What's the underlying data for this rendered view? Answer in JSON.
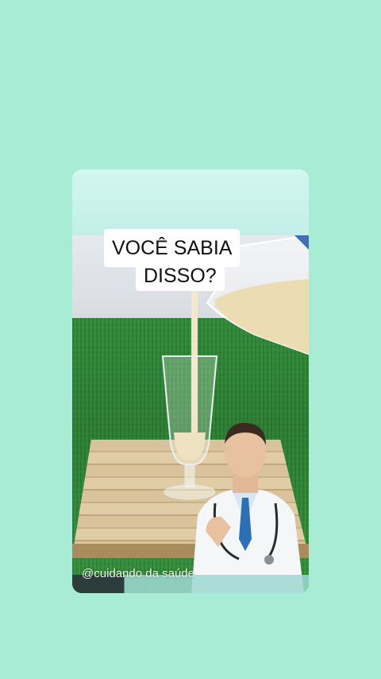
{
  "overlay": {
    "line1": "VOCÊ SABIA",
    "line2": "DISSO?"
  },
  "watermark": "@cuidando da saúde",
  "colors": {
    "background": "#a8ecd6",
    "card": "#c7f3ec",
    "grass": "#2f8a38",
    "board": "#d8c39c",
    "drink": "#eadbb6",
    "coat": "#f4f6f8",
    "tie": "#2d6fb5"
  }
}
